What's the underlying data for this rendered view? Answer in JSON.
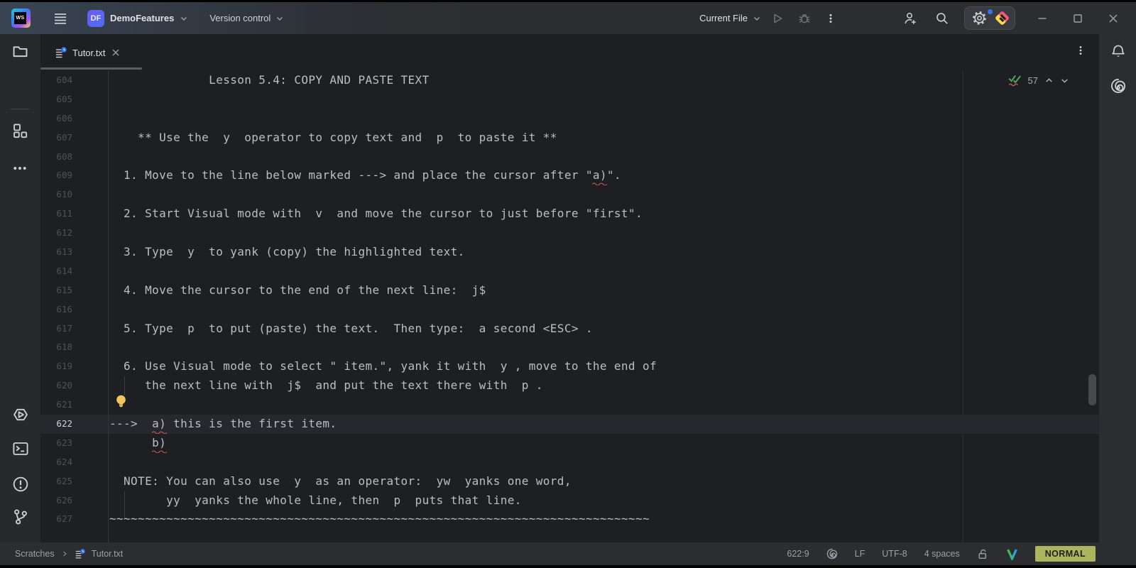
{
  "window": {
    "controls": {
      "minimize": "minimize",
      "maximize": "maximize",
      "close": "close"
    }
  },
  "toolbar": {
    "project_initials": "DF",
    "project_name": "DemoFeatures",
    "vcs_label": "Version control",
    "run_config": "Current File"
  },
  "tabbar": {
    "tab_label": "Tutor.txt"
  },
  "editor": {
    "current_line": 622,
    "inspections_count": "57",
    "lines": [
      {
        "no": 604,
        "text": "              Lesson 5.4: COPY AND PASTE TEXT"
      },
      {
        "no": 605,
        "text": ""
      },
      {
        "no": 606,
        "text": ""
      },
      {
        "no": 607,
        "text": "    ** Use the  y  operator to copy text and  p  to paste it **"
      },
      {
        "no": 608,
        "text": ""
      },
      {
        "no": 609,
        "text": "  1. Move to the line below marked ---> and place the cursor after \"a)\"."
      },
      {
        "no": 610,
        "text": ""
      },
      {
        "no": 611,
        "text": "  2. Start Visual mode with  v  and move the cursor to just before \"first\"."
      },
      {
        "no": 612,
        "text": ""
      },
      {
        "no": 613,
        "text": "  3. Type  y  to yank (copy) the highlighted text."
      },
      {
        "no": 614,
        "text": ""
      },
      {
        "no": 615,
        "text": "  4. Move the cursor to the end of the next line:  j$"
      },
      {
        "no": 616,
        "text": ""
      },
      {
        "no": 617,
        "text": "  5. Type  p  to put (paste) the text.  Then type:  a second <ESC> ."
      },
      {
        "no": 618,
        "text": ""
      },
      {
        "no": 619,
        "text": "  6. Use Visual mode to select \" item.\", yank it with  y , move to the end of"
      },
      {
        "no": 620,
        "text": "     the next line with  j$  and put the text there with  p ."
      },
      {
        "no": 621,
        "text": ""
      },
      {
        "no": 622,
        "text": "--->  a) this is the first item."
      },
      {
        "no": 623,
        "text": "      b)"
      },
      {
        "no": 624,
        "text": ""
      },
      {
        "no": 625,
        "text": "  NOTE: You can also use  y  as an operator:  yw  yanks one word,"
      },
      {
        "no": 626,
        "text": "        yy  yanks the whole line, then  p  puts that line."
      },
      {
        "no": 627,
        "text": "~~~~~~~~~~~~~~~~~~~~~~~~~~~~~~~~~~~~~~~~~~~~~~~~~~~~~~~~~~~~~~~~~~~~~~~~~~~~"
      }
    ]
  },
  "statusbar": {
    "breadcrumb_root": "Scratches",
    "breadcrumb_file": "Tutor.txt",
    "caret": "622:9",
    "line_ending": "LF",
    "encoding": "UTF-8",
    "indent": "4 spaces",
    "vim_mode": "NORMAL"
  },
  "colors": {
    "accent_blue": "#3574f0",
    "vim_mode_badge": "#adb45e",
    "typo_squiggle": "#cf5b56",
    "inspection_green": "#4fa45a",
    "editor_bg": "#1e1f22",
    "panel_bg": "#2b2d30"
  },
  "icons": [
    "webstorm-logo",
    "main-menu",
    "chevron-down",
    "run",
    "debug",
    "kebab-menu",
    "add-user",
    "search",
    "settings-gear",
    "ideavim-plugin",
    "minimize",
    "maximize",
    "close",
    "folder",
    "structure",
    "more-tools",
    "run-tool",
    "terminal",
    "problems",
    "git-branch",
    "notifications-bell",
    "ai-assistant",
    "scratch-file",
    "inspections-check",
    "intention-bulb",
    "unlocked",
    "ideavim-v"
  ]
}
